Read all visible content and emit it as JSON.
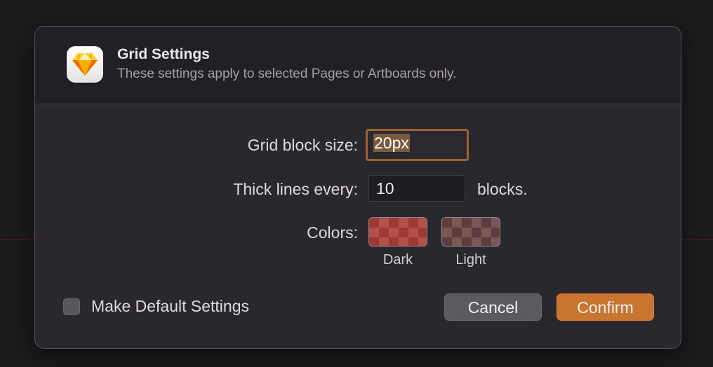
{
  "dialog": {
    "title": "Grid Settings",
    "subtitle": "These settings apply to selected Pages or Artboards only.",
    "app_icon": "sketch-diamond-icon"
  },
  "form": {
    "block_size_label": "Grid block size:",
    "block_size_value": "20px",
    "thick_lines_label": "Thick lines every:",
    "thick_lines_value": "10",
    "thick_lines_suffix": "blocks.",
    "colors_label": "Colors:",
    "dark_label": "Dark",
    "light_label": "Light",
    "dark_color": "#9c3a33",
    "light_color": "#5a3d3c"
  },
  "footer": {
    "make_default_label": "Make Default Settings",
    "make_default_checked": false,
    "cancel_label": "Cancel",
    "confirm_label": "Confirm"
  }
}
